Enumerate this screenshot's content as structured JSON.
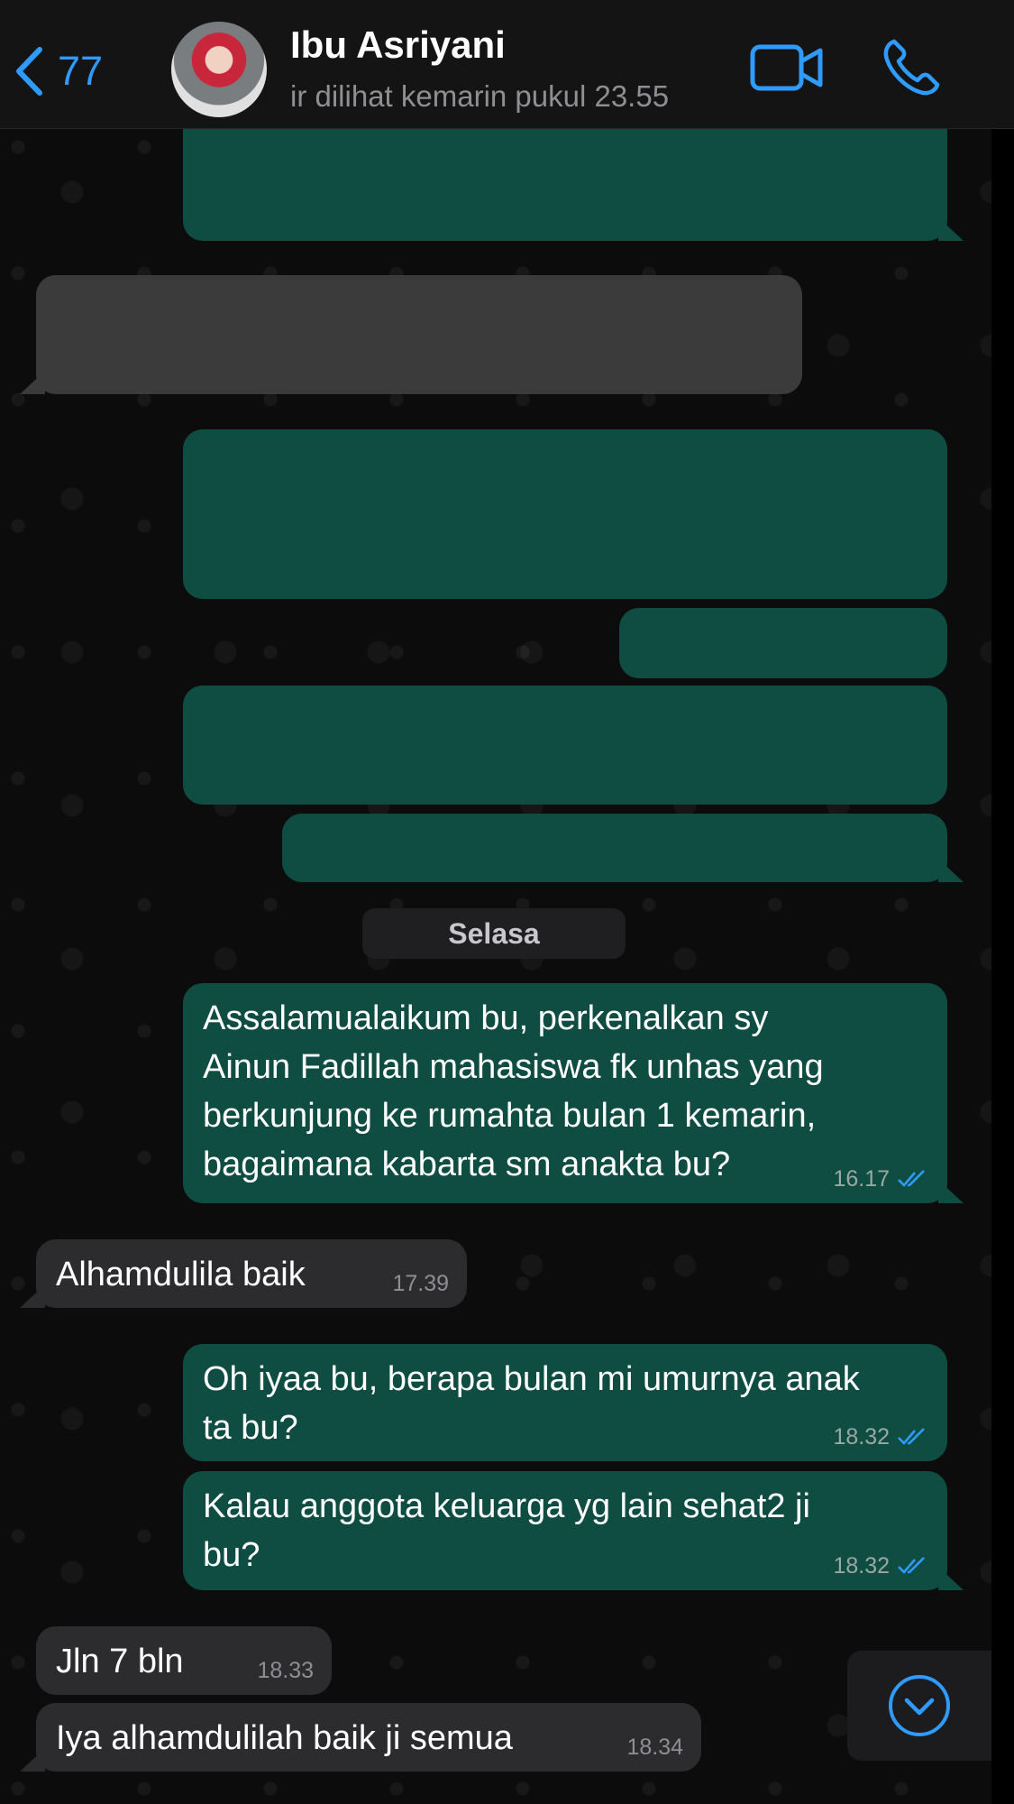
{
  "header": {
    "back_count": "77",
    "contact_name": "Ibu Asriyani",
    "last_seen": "ir dilihat kemarin pukul 23.55"
  },
  "icons": {
    "back": "chevron-left-icon",
    "video": "video-camera-icon",
    "call": "phone-icon",
    "scroll_down": "chevron-down-circle-icon",
    "read_receipt": "double-check-icon"
  },
  "colors": {
    "accent": "#2f9bff",
    "outgoing_bubble": "#0f4d42",
    "incoming_bubble": "#2c2c2e"
  },
  "day_separator": "Selasa",
  "messages": [
    {
      "direction": "out",
      "text": "Assalamualaikum bu, perkenalkan sy",
      "text2": "Ainun Fadillah mahasiswa fk unhas yang",
      "text3": "berkunjung ke rumahta bulan 1 kemarin,",
      "text4": "bagaimana kabarta sm anakta bu?",
      "time": "16.17",
      "read": true
    },
    {
      "direction": "in",
      "text": "Alhamdulila baik",
      "time": "17.39"
    },
    {
      "direction": "out",
      "text": "Oh iyaa bu, berapa bulan mi umurnya anak",
      "text2": "ta bu?",
      "time": "18.32",
      "read": true
    },
    {
      "direction": "out",
      "text": "Kalau anggota keluarga yg lain sehat2 ji",
      "text2": "bu?",
      "time": "18.32",
      "read": true
    },
    {
      "direction": "in",
      "text": "Jln 7 bln",
      "time": "18.33"
    },
    {
      "direction": "in",
      "text": "Iya alhamdulilah baik ji semua",
      "time": "18.34"
    }
  ]
}
